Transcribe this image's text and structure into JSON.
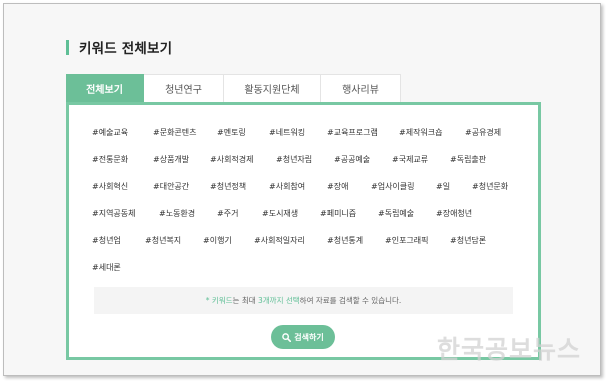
{
  "section_title": "키워드 전체보기",
  "tabs": [
    {
      "label": "전체보기",
      "active": true
    },
    {
      "label": "청년연구",
      "active": false
    },
    {
      "label": "활동지원단체",
      "active": false
    },
    {
      "label": "행사리뷰",
      "active": false
    }
  ],
  "keywords": [
    [
      "#예술교육",
      "#문화콘텐츠",
      "#멘토링",
      "#네트워킹",
      "#교육프로그램",
      "#제작워크숍",
      "#공유경제"
    ],
    [
      "#전통문화",
      "#상품개발",
      "#사회적경제",
      "#청년자립",
      "#공공예술",
      "#국제교류",
      "#독립출판"
    ],
    [
      "#사회혁신",
      "#대안공간",
      "#청년정책",
      "#사회참여",
      "#장애",
      "#업사이클링",
      "#일",
      "#청년문화"
    ],
    [
      "#지역공동체",
      "#노동환경",
      "#주거",
      "#도시재생",
      "#페미니즘",
      "#독립예술",
      "#장애청년"
    ],
    [
      "#청년업",
      "#청년복지",
      "#이행기",
      "#사회적일자리",
      "#청년통계",
      "#인포그래픽",
      "#청년담론"
    ],
    [
      "#세대론"
    ]
  ],
  "notice": {
    "prefix": "* 키워드",
    "mid1": "는 최대 ",
    "highlight": "3개까지 선택",
    "suffix": "하여 자료를 검색할 수 있습니다."
  },
  "search_button": {
    "label": "검색하기",
    "icon": "search-icon"
  },
  "watermark": "한국공보뉴스",
  "colors": {
    "accent": "#6cbf98",
    "panel_border": "#78c8a3",
    "title_bar": "#5fbf96"
  }
}
